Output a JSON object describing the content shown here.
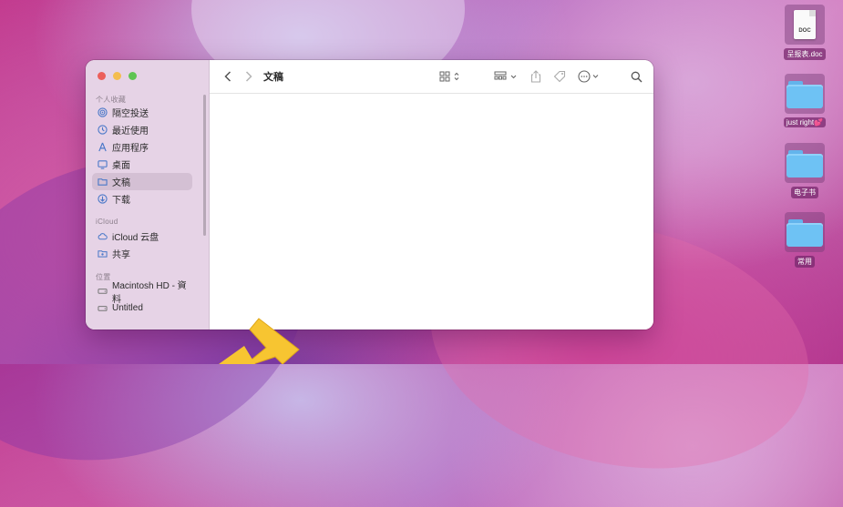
{
  "window": {
    "title": "文稿"
  },
  "sidebar": {
    "sections": [
      {
        "title": "个人收藏",
        "items": [
          {
            "label": "隔空投送",
            "icon": "airdrop-icon"
          },
          {
            "label": "最近使用",
            "icon": "clock-icon"
          },
          {
            "label": "应用程序",
            "icon": "applications-icon"
          },
          {
            "label": "桌面",
            "icon": "desktop-icon"
          },
          {
            "label": "文稿",
            "icon": "document-folder-icon",
            "selected": true
          },
          {
            "label": "下载",
            "icon": "download-icon"
          }
        ]
      },
      {
        "title": "iCloud",
        "items": [
          {
            "label": "iCloud 云盘",
            "icon": "cloud-icon"
          },
          {
            "label": "共享",
            "icon": "shared-folder-icon"
          }
        ]
      },
      {
        "title": "位置",
        "items": [
          {
            "label": "Macintosh HD - 資料",
            "icon": "disk-icon"
          },
          {
            "label": "Untitled",
            "icon": "disk-icon"
          }
        ]
      }
    ]
  },
  "toolbar": {
    "icons": [
      "back-icon",
      "forward-icon",
      "view-mode-icon",
      "group-icon",
      "share-icon",
      "tag-icon",
      "more-icon",
      "search-icon"
    ]
  },
  "desktop": {
    "icons": [
      {
        "label": "呈报表.doc",
        "type": "doc",
        "doc_badge": "DOC"
      },
      {
        "label": "just right💕",
        "type": "folder"
      },
      {
        "label": "电子书",
        "type": "folder"
      },
      {
        "label": "常用",
        "type": "folder"
      }
    ]
  },
  "colors": {
    "sidebar_bg": "#e6d3e6",
    "selected_bg": "#d4c0d4",
    "folder_blue": "#6ec2f4",
    "arrow_yellow": "#f7c531"
  }
}
